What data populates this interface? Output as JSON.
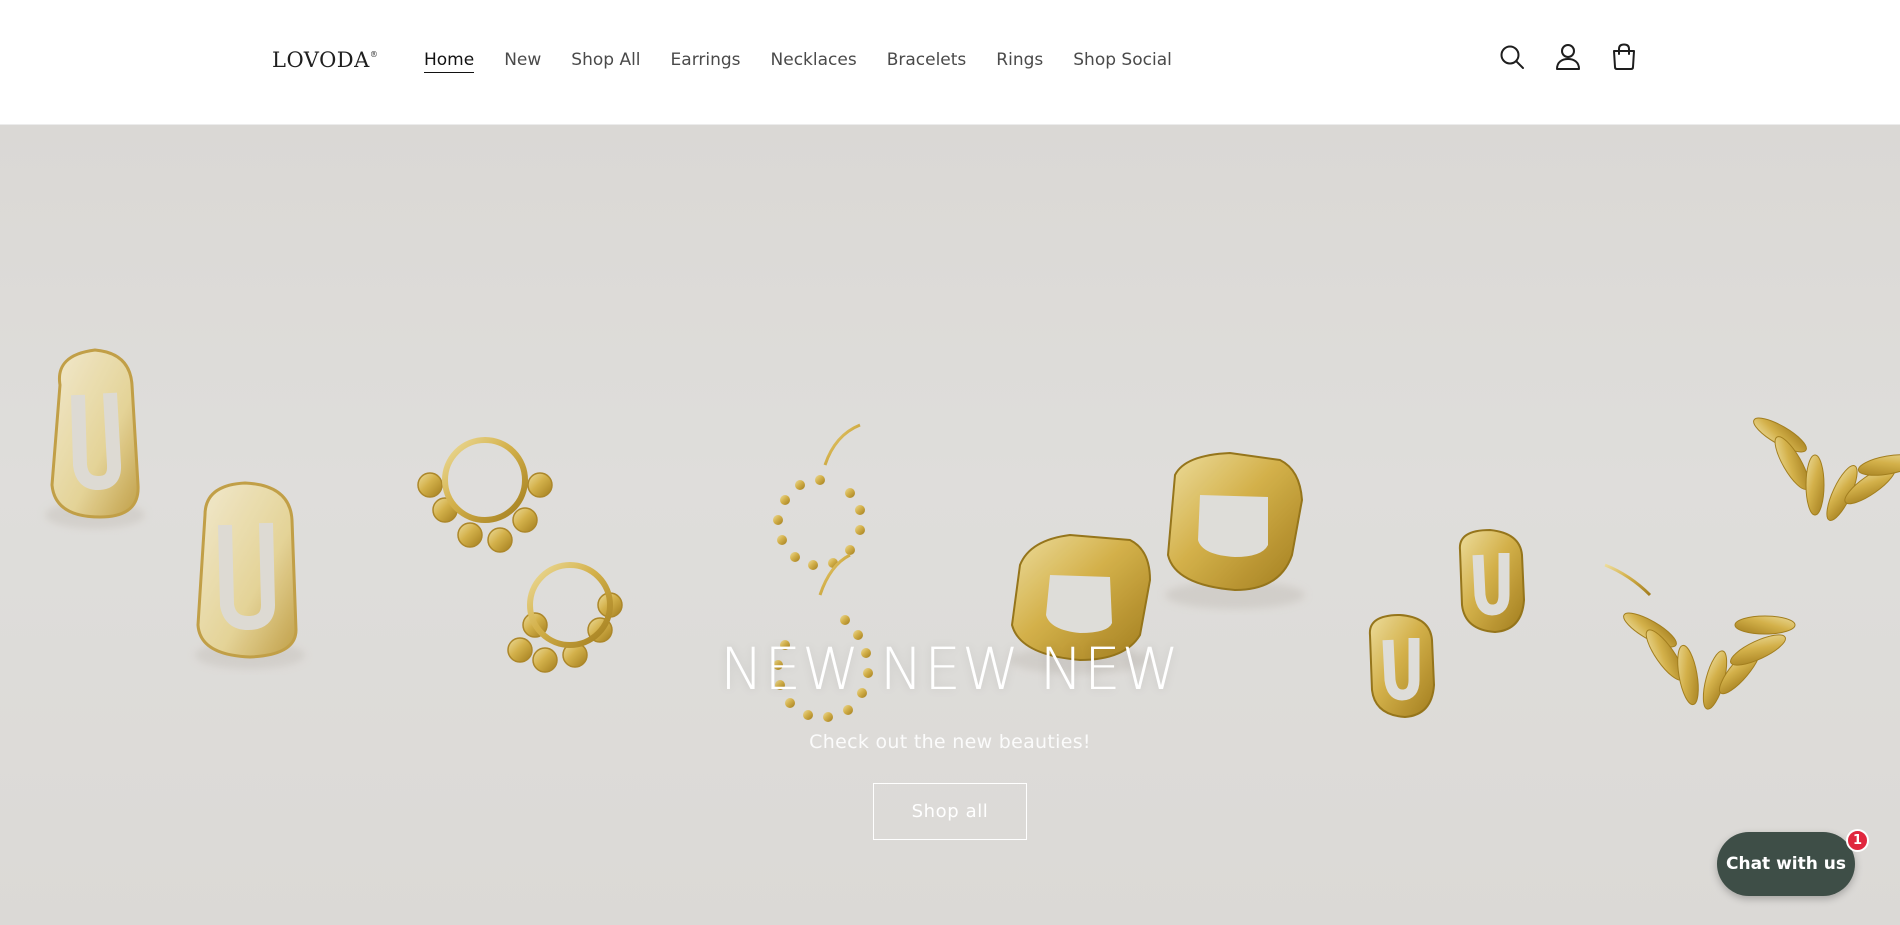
{
  "header": {
    "logo": "LOVODA",
    "nav": [
      {
        "label": "Home",
        "active": true
      },
      {
        "label": "New"
      },
      {
        "label": "Shop All"
      },
      {
        "label": "Earrings"
      },
      {
        "label": "Necklaces"
      },
      {
        "label": "Bracelets"
      },
      {
        "label": "Rings"
      },
      {
        "label": "Shop Social"
      }
    ],
    "icons": [
      "search-icon",
      "account-icon",
      "cart-icon"
    ]
  },
  "hero": {
    "title": "NEW NEW NEW",
    "subtitle": "Check out the new beauties!",
    "button_label": "Shop all",
    "background_color": "#e6e4e1",
    "jewelry_color": "#d9b84a"
  },
  "chat": {
    "label": "Chat with us",
    "badge": "1",
    "color": "#3e4e47",
    "badge_color": "#e0273e"
  }
}
